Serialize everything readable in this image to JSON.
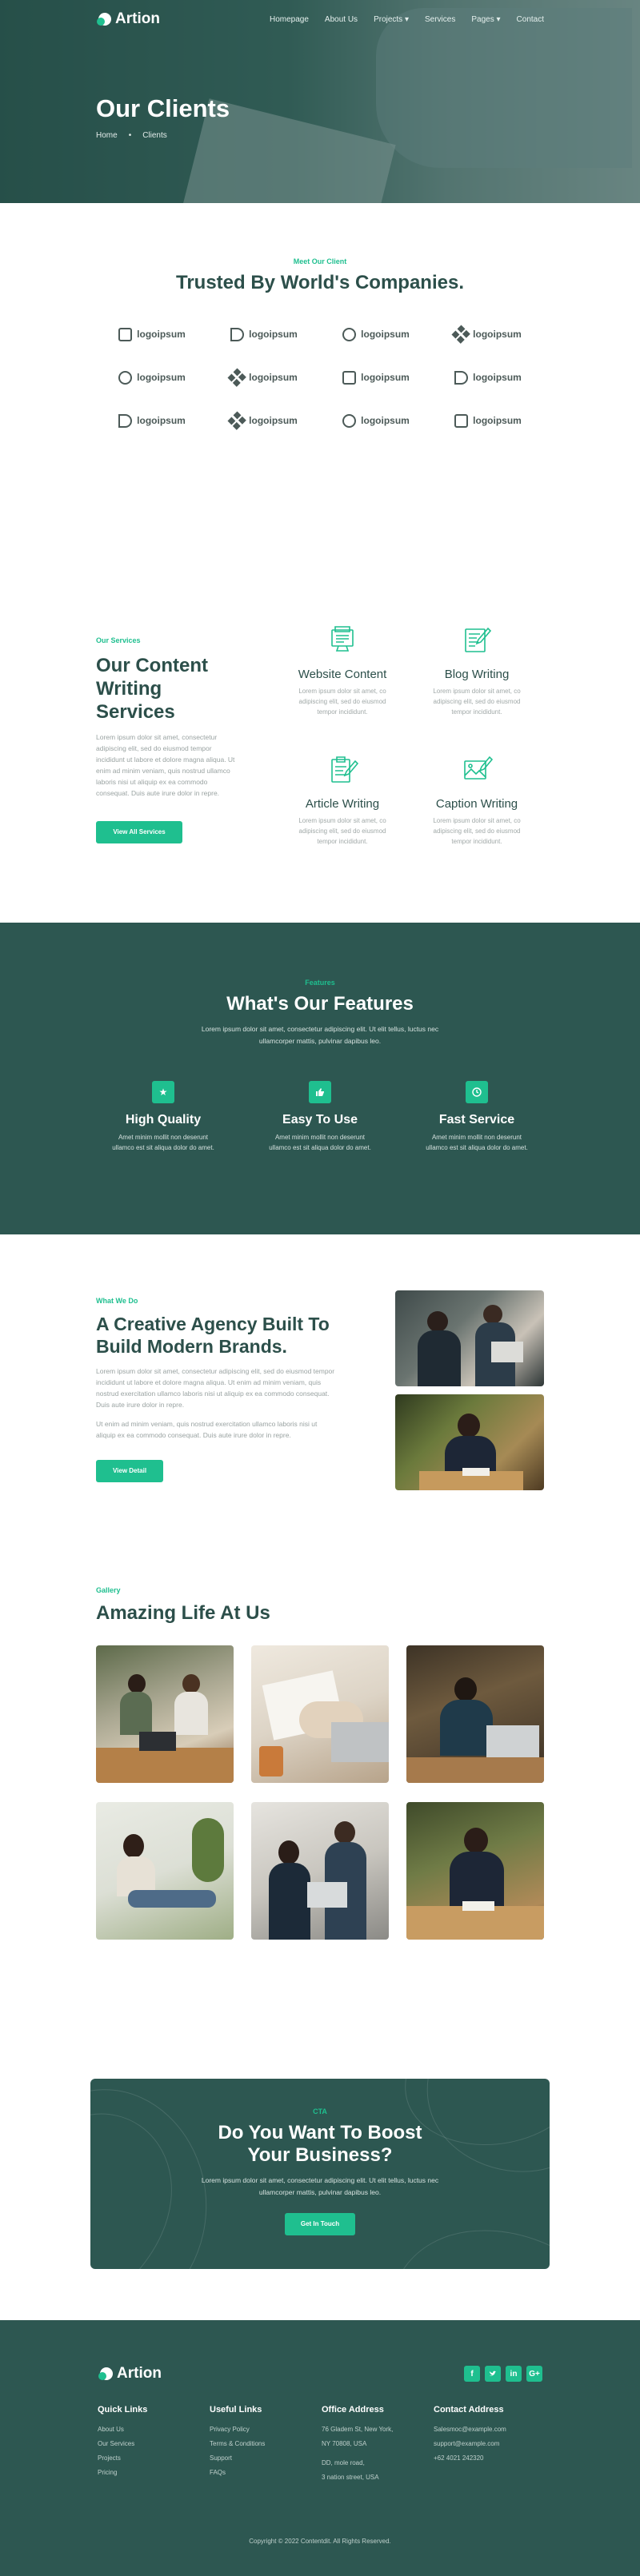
{
  "nav": {
    "brand": "Artion",
    "links": [
      "Homepage",
      "About Us",
      "Projects",
      "Services",
      "Pages",
      "Contact"
    ],
    "dropdowns": [
      "Projects",
      "Pages"
    ]
  },
  "hero": {
    "title": "Our Clients",
    "breadcrumb": [
      "Home",
      "Clients"
    ]
  },
  "clients": {
    "eyebrow": "Meet Our Client",
    "title": "Trusted By World's Companies.",
    "logos": [
      "logoipsum",
      "logoipsum",
      "logoipsum",
      "logoipsum",
      "logoipsum",
      "logoipsum",
      "logoipsum",
      "logoipsum",
      "logoipsum",
      "logoipsum",
      "logoipsum",
      "logoipsum"
    ]
  },
  "services": {
    "eyebrow": "Our Services",
    "title": "Our Content Writing Services",
    "text": "Lorem ipsum dolor sit amet, consectetur adipiscing elit, sed do eiusmod tempor incididunt ut labore et dolore magna aliqua. Ut enim ad minim veniam, quis nostrud ullamco laboris nisi ut aliquip ex ea commodo consequat. Duis aute irure dolor in repre.",
    "button": "View All Services",
    "cards": [
      {
        "title": "Website Content",
        "text": "Lorem ipsum dolor sit amet, co adipiscing elit, sed do eiusmod tempor incididunt."
      },
      {
        "title": "Blog Writing",
        "text": "Lorem ipsum dolor sit amet, co adipiscing elit, sed do eiusmod tempor incididunt."
      },
      {
        "title": "Article Writing",
        "text": "Lorem ipsum dolor sit amet, co adipiscing elit, sed do eiusmod tempor incididunt."
      },
      {
        "title": "Caption Writing",
        "text": "Lorem ipsum dolor sit amet, co adipiscing elit, sed do eiusmod tempor incididunt."
      }
    ]
  },
  "features": {
    "eyebrow": "Features",
    "title": "What's Our Features",
    "subtitle": "Lorem ipsum dolor sit amet, consectetur adipiscing elit. Ut elit tellus, luctus nec ullamcorper mattis, pulvinar dapibus leo.",
    "items": [
      {
        "icon": "star-icon",
        "title": "High Quality",
        "text": "Amet minim mollit non deserunt ullamco est sit aliqua dolor do amet."
      },
      {
        "icon": "thumbs-up-icon",
        "title": "Easy To Use",
        "text": "Amet minim mollit non deserunt ullamco est sit aliqua dolor do amet."
      },
      {
        "icon": "clock-icon",
        "title": "Fast Service",
        "text": "Amet minim mollit non deserunt ullamco est sit aliqua dolor do amet."
      }
    ]
  },
  "about": {
    "eyebrow": "What We Do",
    "title": "A Creative Agency Built To Build Modern Brands.",
    "text1": "Lorem ipsum dolor sit amet, consectetur adipiscing elit, sed do eiusmod tempor incididunt ut labore et dolore magna aliqua. Ut enim ad minim veniam, quis nostrud exercitation ullamco laboris nisi ut aliquip ex ea commodo consequat. Duis aute irure dolor in repre.",
    "text2": "Ut enim ad minim veniam, quis nostrud exercitation ullamco laboris nisi ut aliquip ex ea commodo consequat. Duis aute irure dolor in repre.",
    "button": "View Detail"
  },
  "gallery": {
    "eyebrow": "Gallery",
    "title": "Amazing Life At Us"
  },
  "cta": {
    "eyebrow": "CTA",
    "title": "Do You Want To Boost Your Business?",
    "text": "Lorem ipsum dolor sit amet, consectetur adipiscing elit. Ut elit tellus, luctus nec ullamcorper mattis, pulvinar dapibus leo.",
    "button": "Get In Touch"
  },
  "footer": {
    "brand": "Artion",
    "socials": [
      "facebook-icon",
      "twitter-icon",
      "linkedin-icon",
      "google-plus-icon"
    ],
    "quick_links": {
      "title": "Quick Links",
      "items": [
        "About Us",
        "Our Services",
        "Projects",
        "Pricing"
      ]
    },
    "useful_links": {
      "title": "Useful Links",
      "items": [
        "Privacy Policy",
        "Terms & Conditions",
        "Support",
        "FAQs"
      ]
    },
    "office": {
      "title": "Office Address",
      "lines": [
        "76 Gladem St, New York,",
        "NY 70808, USA",
        "",
        "DD, mole road,",
        "3 nation street, USA"
      ]
    },
    "contact": {
      "title": "Contact Address",
      "lines": [
        "Salesmoc@example.com",
        "support@example.com",
        "+62 4021 242320"
      ]
    },
    "copyright": "Copyright © 2022 Contentdit. All Rights Reserved."
  },
  "colors": {
    "accent": "#1fbf8f",
    "dark": "#2d5751",
    "heading": "#2c4f4a"
  }
}
